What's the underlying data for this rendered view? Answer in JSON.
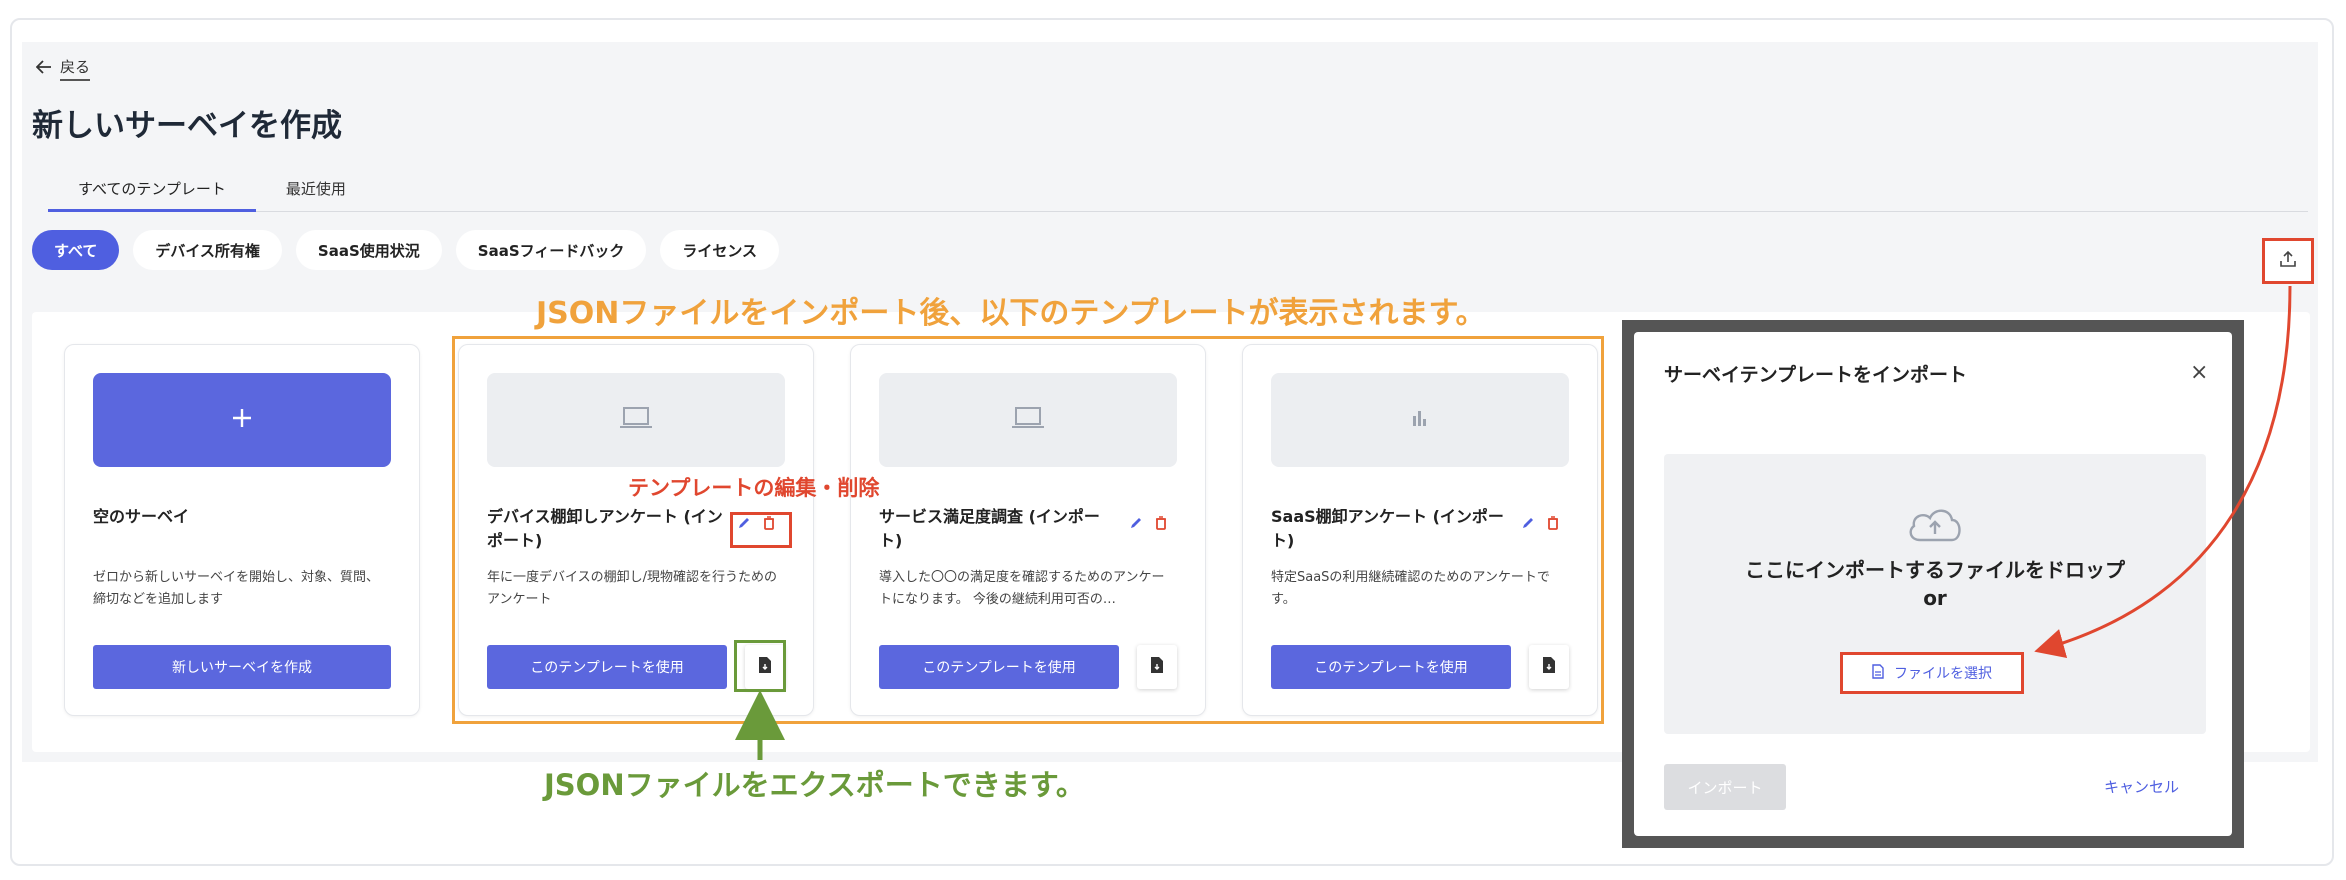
{
  "header": {
    "back_label": "戻る",
    "page_title": "新しいサーベイを作成"
  },
  "tabs": [
    {
      "label": "すべてのテンプレート",
      "active": true
    },
    {
      "label": "最近使用",
      "active": false
    }
  ],
  "filters": [
    {
      "label": "すべて",
      "active": true
    },
    {
      "label": "デバイス所有権",
      "active": false
    },
    {
      "label": "SaaS使用状況",
      "active": false
    },
    {
      "label": "SaaSフィードバック",
      "active": false
    },
    {
      "label": "ライセンス",
      "active": false
    }
  ],
  "cards": [
    {
      "title": "空のサーベイ",
      "description": "ゼロから新しいサーベイを開始し、対象、質問、締切などを追加します",
      "button": "新しいサーベイを作成",
      "thumb_icon": "plus-icon"
    },
    {
      "title": "デバイス棚卸しアンケート (インポート)",
      "description": "年に一度デバイスの棚卸し/現物確認を行うためのアンケート",
      "button": "このテンプレートを使用",
      "thumb_icon": "laptop-icon"
    },
    {
      "title": "サービス満足度調査 (インポート)",
      "description": "導入した〇〇の満足度を確認するためのアンケートになります。 今後の継続利用可否の…",
      "button": "このテンプレートを使用",
      "thumb_icon": "laptop-icon"
    },
    {
      "title": "SaaS棚卸アンケート (インポート)",
      "description": "特定SaaSの利用継続確認のためのアンケートです。",
      "button": "このテンプレートを使用",
      "thumb_icon": "bar-chart-icon"
    }
  ],
  "annotations": {
    "orange": "JSONファイルをインポート後、以下のテンプレートが表示されます。",
    "red": "テンプレートの編集・削除",
    "green": "JSONファイルをエクスポートできます。"
  },
  "modal": {
    "title": "サーベイテンプレートをインポート",
    "close": "×",
    "drop_text": "ここにインポートするファイルをドロップ",
    "or": "or",
    "file_button": "ファイルを選択",
    "import_button": "インポート",
    "cancel_button": "キャンセル"
  },
  "colors": {
    "accent": "#5b67de",
    "annotation_orange": "#f0a23c",
    "annotation_red": "#e0472f",
    "annotation_green": "#6a9a3a",
    "delete_red": "#e0472f"
  }
}
